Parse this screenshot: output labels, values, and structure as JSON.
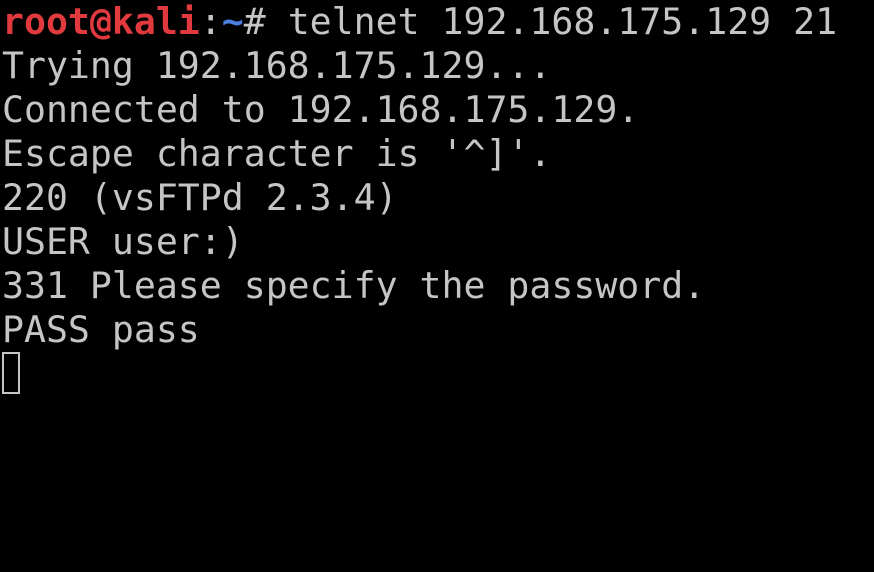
{
  "colors": {
    "background": "#000000",
    "text": "#c5c5c5",
    "prompt_user": "#e0393e",
    "prompt_path": "#4a7ee0"
  },
  "prompt": {
    "user_host": "root@kali",
    "separator": ":",
    "path": "~",
    "symbol": "# ",
    "command": "telnet 192.168.175.129 21"
  },
  "output": [
    "Trying 192.168.175.129...",
    "Connected to 192.168.175.129.",
    "Escape character is '^]'.",
    "220 (vsFTPd 2.3.4)",
    "USER user:)",
    "331 Please specify the password.",
    "PASS pass"
  ],
  "cursor": {
    "style": "hollow-block"
  }
}
